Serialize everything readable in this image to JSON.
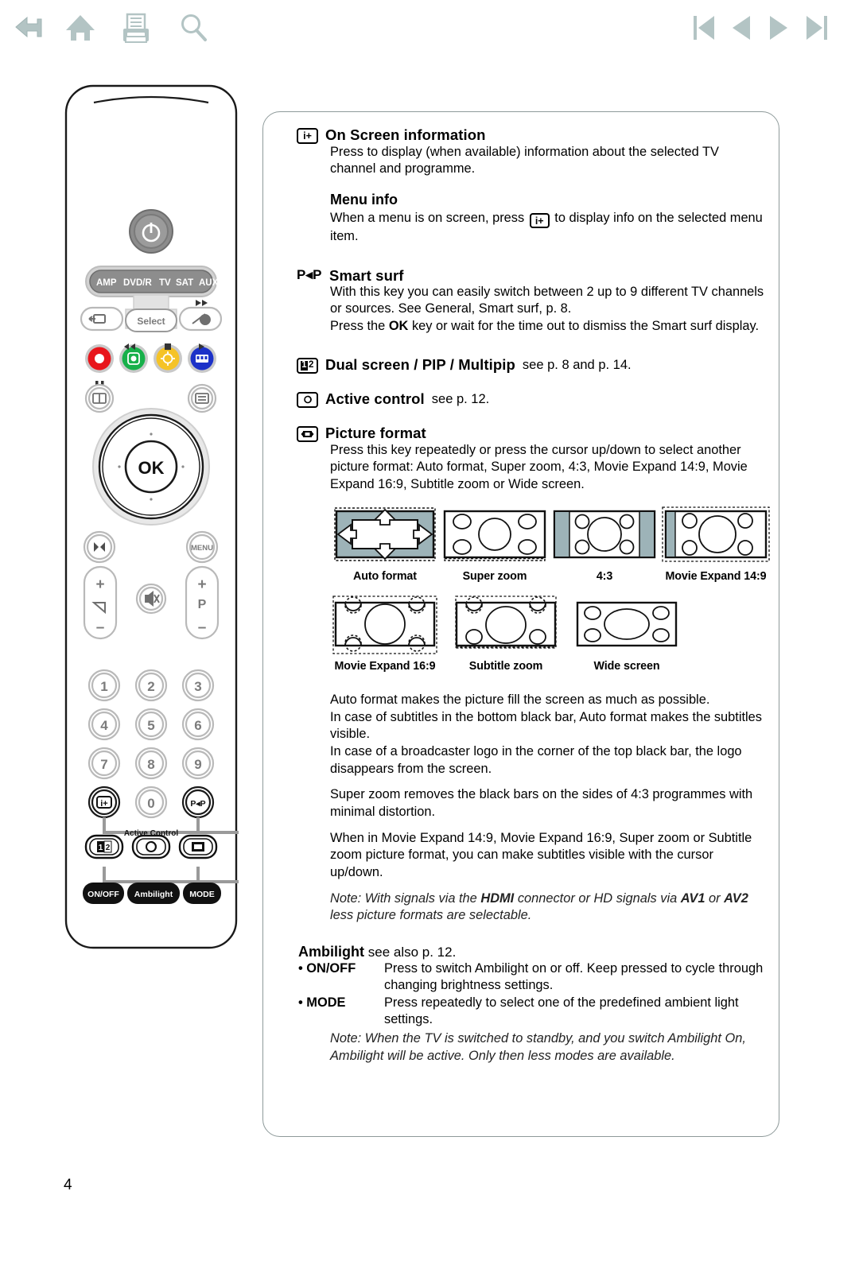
{
  "toolbar": {
    "icons": [
      {
        "name": "back-icon",
        "label": "Back"
      },
      {
        "name": "home-icon",
        "label": "Home"
      },
      {
        "name": "print-icon",
        "label": "Print"
      },
      {
        "name": "search-icon",
        "label": "Search"
      },
      {
        "name": "first-page-icon",
        "label": "First page"
      },
      {
        "name": "previous-page-icon",
        "label": "Previous page"
      },
      {
        "name": "next-page-icon",
        "label": "Next page"
      },
      {
        "name": "last-page-icon",
        "label": "Last page"
      }
    ],
    "accent_color": "#b3c4c4"
  },
  "remote": {
    "mode_buttons": [
      "AMP",
      "DVD/R",
      "TV",
      "SAT",
      "AUX"
    ],
    "select_label": "Select",
    "ok_label": "OK",
    "menu_label": "MENU",
    "p_label": "P",
    "pip_label": "P◂P",
    "numbers": [
      "1",
      "2",
      "3",
      "4",
      "5",
      "6",
      "7",
      "8",
      "9",
      "0"
    ],
    "active_control_label": "Active Control",
    "ambilight_label": "Ambilight",
    "onoff_label": "ON/OFF",
    "mode_label": "MODE",
    "colors": {
      "record": "#e8151b",
      "green": "#17b04a",
      "yellow": "#f5c327",
      "blue": "#1c31c8",
      "body_gray": "#b9b9b9",
      "panel_gray": "#d9d9d9"
    }
  },
  "sections": {
    "osi": {
      "title": "On Screen information",
      "badge": "i+",
      "body": "Press to display (when available) information about the selected TV channel and programme."
    },
    "menu_info": {
      "title": "Menu info",
      "body_part1": "When a menu is on screen, press",
      "badge": "i+",
      "body_part2": "to display info on the selected menu item."
    },
    "smart_surf": {
      "title": "Smart surf",
      "badge": "P◂P",
      "line1": "With this key you can easily switch between 2 up to 9 different TV channels or sources. See General, Smart surf, p. 8.",
      "line2_a": "Press the",
      "line2_b": "OK",
      "line2_c": "key or wait for the time out to dismiss the Smart surf display."
    },
    "dual_screen": {
      "title": "Dual screen / PIP / Multipip",
      "suffix": "see p. 8 and p. 14."
    },
    "active_control": {
      "title": "Active control",
      "suffix": "see p. 12."
    },
    "picture_format": {
      "title": "Picture format",
      "body": "Press this key repeatedly or press the cursor up/down to select another picture format: Auto format, Super zoom, 4:3, Movie Expand 14:9, Movie Expand 16:9, Subtitle zoom or Wide screen.",
      "para1": "Auto format makes the picture fill the screen as much as possible.\nIn case of subtitles in the bottom black bar, Auto format makes the subtitles visible.\nIn case of a broadcaster logo in the corner of the top black bar, the logo disappears from the screen.",
      "para2": "Super zoom removes the black bars on the sides of 4:3 programmes with minimal distortion.",
      "para3": "When in Movie Expand 14:9, Movie Expand 16:9, Super zoom or Subtitle zoom picture format, you can make subtitles visible with the cursor up/down.",
      "note_a": "Note: With signals via the",
      "note_b": "HDMI",
      "note_c": "connector or HD signals via",
      "note_d": "AV1",
      "note_e": "or",
      "note_f": "AV2",
      "note_g": "less picture formats are selectable."
    },
    "ambilight": {
      "title": "Ambilight",
      "title_suffix": "see also p. 12.",
      "items": [
        {
          "key": "ON/OFF",
          "text": "Press to switch Ambilight on or off. Keep pressed to cycle through changing brightness settings."
        },
        {
          "key": "MODE",
          "text": "Press repeatedly to select one of the predefined ambient light settings."
        }
      ],
      "note": "Note: When the TV is switched to standby, and you switch Ambilight On, Ambilight will be active. Only then less modes are available."
    }
  },
  "figures": {
    "row1": [
      {
        "label": "Auto format",
        "type": "auto"
      },
      {
        "label": "Super zoom",
        "type": "superzoom"
      },
      {
        "label": "4:3",
        "type": "fourthree"
      },
      {
        "label": "Movie Expand 14:9",
        "type": "me149"
      }
    ],
    "row2": [
      {
        "label": "Movie Expand 16:9",
        "type": "me169"
      },
      {
        "label": "Subtitle zoom",
        "type": "subtitle"
      },
      {
        "label": "Wide screen",
        "type": "wide"
      }
    ],
    "bar_color": "#9db3b8"
  },
  "page": {
    "number": "4"
  }
}
